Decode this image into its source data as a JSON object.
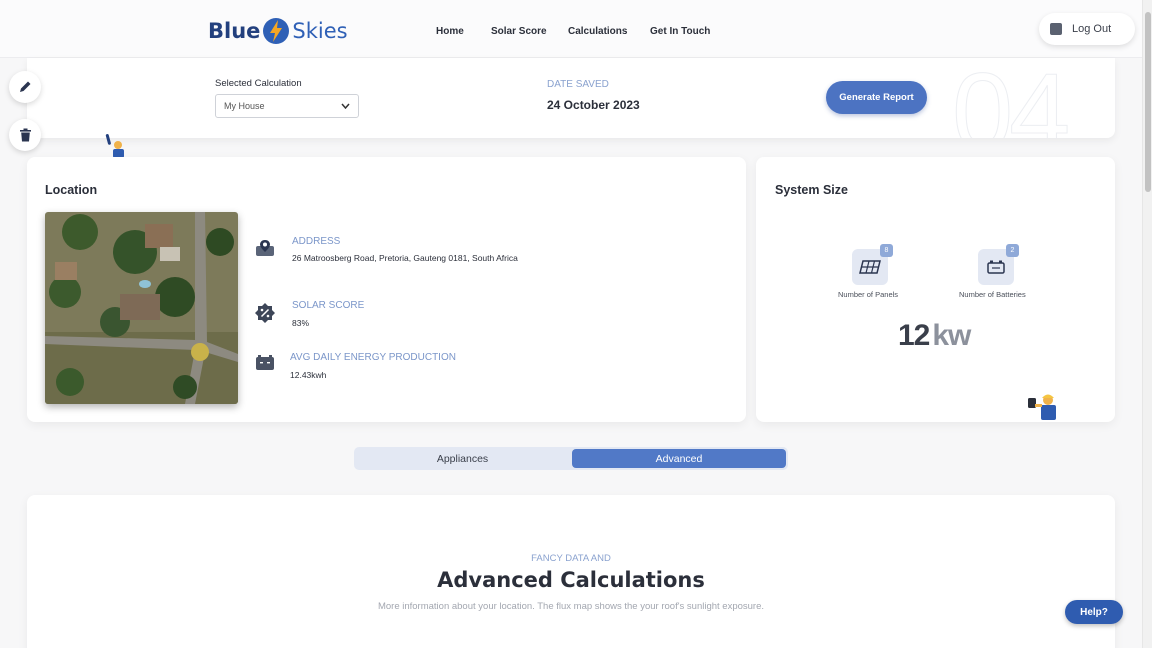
{
  "nav": {
    "logo_left": "Blue",
    "logo_right": "Skies",
    "links": [
      "Home",
      "Solar Score",
      "Calculations",
      "Get In Touch"
    ],
    "logout": "Log Out"
  },
  "toolbar": {
    "selected_label": "Selected Calculation",
    "selected_value": "My House",
    "date_label": "DATE SAVED",
    "date_value": "24 October 2023",
    "generate_label": "Generate Report",
    "watermark": "04"
  },
  "location": {
    "title": "Location",
    "address_label": "ADDRESS",
    "address_value": "26 Matroosberg Road, Pretoria, Gauteng 0181, South Africa",
    "score_label": "SOLAR SCORE",
    "score_value": "83%",
    "energy_label": "AVG DAILY ENERGY PRODUCTION",
    "energy_value": "12.43kwh"
  },
  "system": {
    "title": "System Size",
    "panels_count": "8",
    "panels_label": "Number of Panels",
    "batteries_count": "2",
    "batteries_label": "Number of Batteries",
    "size_value": "12",
    "size_unit": "kw"
  },
  "toggle": {
    "left": "Appliances",
    "right": "Advanced",
    "active": "Advanced"
  },
  "advanced": {
    "kicker": "FANCY DATA AND",
    "title": "Advanced Calculations",
    "description": "More information about your location. The flux map shows the your roof's sunlight exposure."
  },
  "help": "Help?",
  "colors": {
    "brand_dark": "#23407e",
    "brand_blue": "#4c73c2",
    "accent_label": "#7b96c9",
    "lightning": "#f5a623"
  }
}
